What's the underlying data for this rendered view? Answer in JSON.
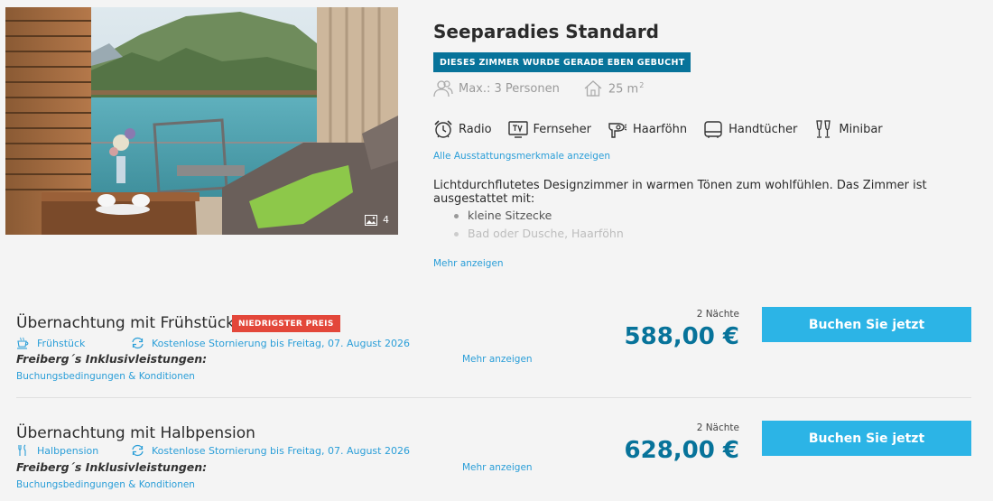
{
  "room": {
    "title": "Seeparadies Standard",
    "booked_badge": "DIESES ZIMMER WURDE GERADE EBEN GEBUCHT",
    "max_persons": "Max.: 3 Personen",
    "size": "25 m",
    "size_unit_sup": "2",
    "photo_count": "4",
    "amenities": [
      {
        "label": "Radio",
        "icon": "alarm-clock-icon"
      },
      {
        "label": "Fernseher",
        "icon": "tv-icon"
      },
      {
        "label": "Haarföhn",
        "icon": "hair-dryer-icon"
      },
      {
        "label": "Handtücher",
        "icon": "towel-icon"
      },
      {
        "label": "Minibar",
        "icon": "champagne-glasses-icon"
      }
    ],
    "all_features_link": "Alle Ausstattungsmerkmale anzeigen",
    "description": "Lichtdurchflutetes Designzimmer in warmen Tönen zum wohlfühlen. Das Zimmer ist ausgestattet mit:",
    "bullets": [
      "kleine Sitzecke",
      "Bad oder Dusche, Haarföhn"
    ],
    "more_link": "Mehr anzeigen"
  },
  "rates": [
    {
      "title": "Übernachtung mit Frühstück",
      "badge": "NIEDRIGSTER PREIS",
      "meal": "Frühstück",
      "meal_icon": "coffee-cup-icon",
      "cancellation": "Kostenlose Stornierung bis Freitag, 07. August 2026",
      "inclusive": "Freiberg´s Inklusivleistungen:",
      "more_link": "Mehr anzeigen",
      "conditions_link": "Buchungsbedingungen & Konditionen",
      "nights": "2 Nächte",
      "price": "588,00 €",
      "book_label": "Buchen Sie jetzt"
    },
    {
      "title": "Übernachtung mit Halbpension",
      "meal": "Halbpension",
      "meal_icon": "fork-knife-icon",
      "cancellation": "Kostenlose Stornierung bis Freitag, 07. August 2026",
      "inclusive": "Freiberg´s Inklusivleistungen:",
      "more_link": "Mehr anzeigen",
      "conditions_link": "Buchungsbedingungen & Konditionen",
      "nights": "2 Nächte",
      "price": "628,00 €",
      "book_label": "Buchen Sie jetzt"
    }
  ],
  "colors": {
    "brand_blue": "#07739a",
    "link_blue": "#2a9ed8",
    "button_blue": "#2cb4e6",
    "badge_red": "#e3473a"
  }
}
